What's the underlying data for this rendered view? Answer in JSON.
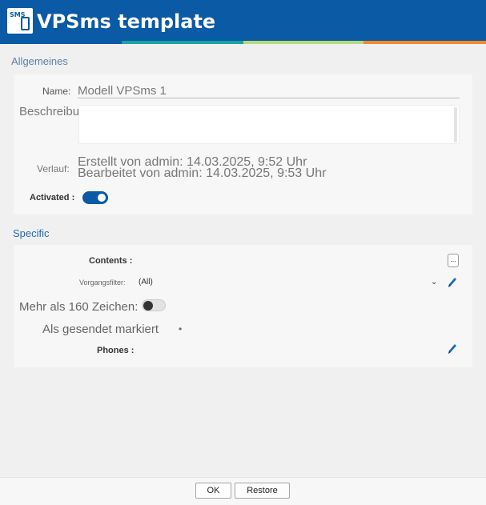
{
  "window": {
    "title": "VPSms template",
    "icon_text": "SMS"
  },
  "accent_colors": [
    "#0a5aa6",
    "#1aa3a0",
    "#b9d87a",
    "#f08a2c"
  ],
  "general": {
    "section_title": "Allgemeines",
    "name_label": "Name:",
    "name_value": "Modell VPSms 1",
    "description_label": "Beschreibung:",
    "description_value": "",
    "history_label": "Verlauf:",
    "history_created": "Erstellt von admin: 14.03.2025, 9:52 Uhr",
    "history_modified": "Bearbeitet von admin: 14.03.2025, 9:53 Uhr",
    "activated_label": "Activated :",
    "activated": true
  },
  "specific": {
    "section_title": "Specific",
    "contents_label": "Contents :",
    "contents_button": "...",
    "filter_label": "Vorgangsfilter:",
    "filter_value": "(All)",
    "long_sms_label": "Mehr als 160 Zeichen:",
    "long_sms": false,
    "mark_sent_label": "Als gesendet markiert",
    "mark_sent_bullet": "•",
    "phones_label": "Phones :"
  },
  "footer": {
    "ok_label": "OK",
    "restore_label": "Restore"
  }
}
